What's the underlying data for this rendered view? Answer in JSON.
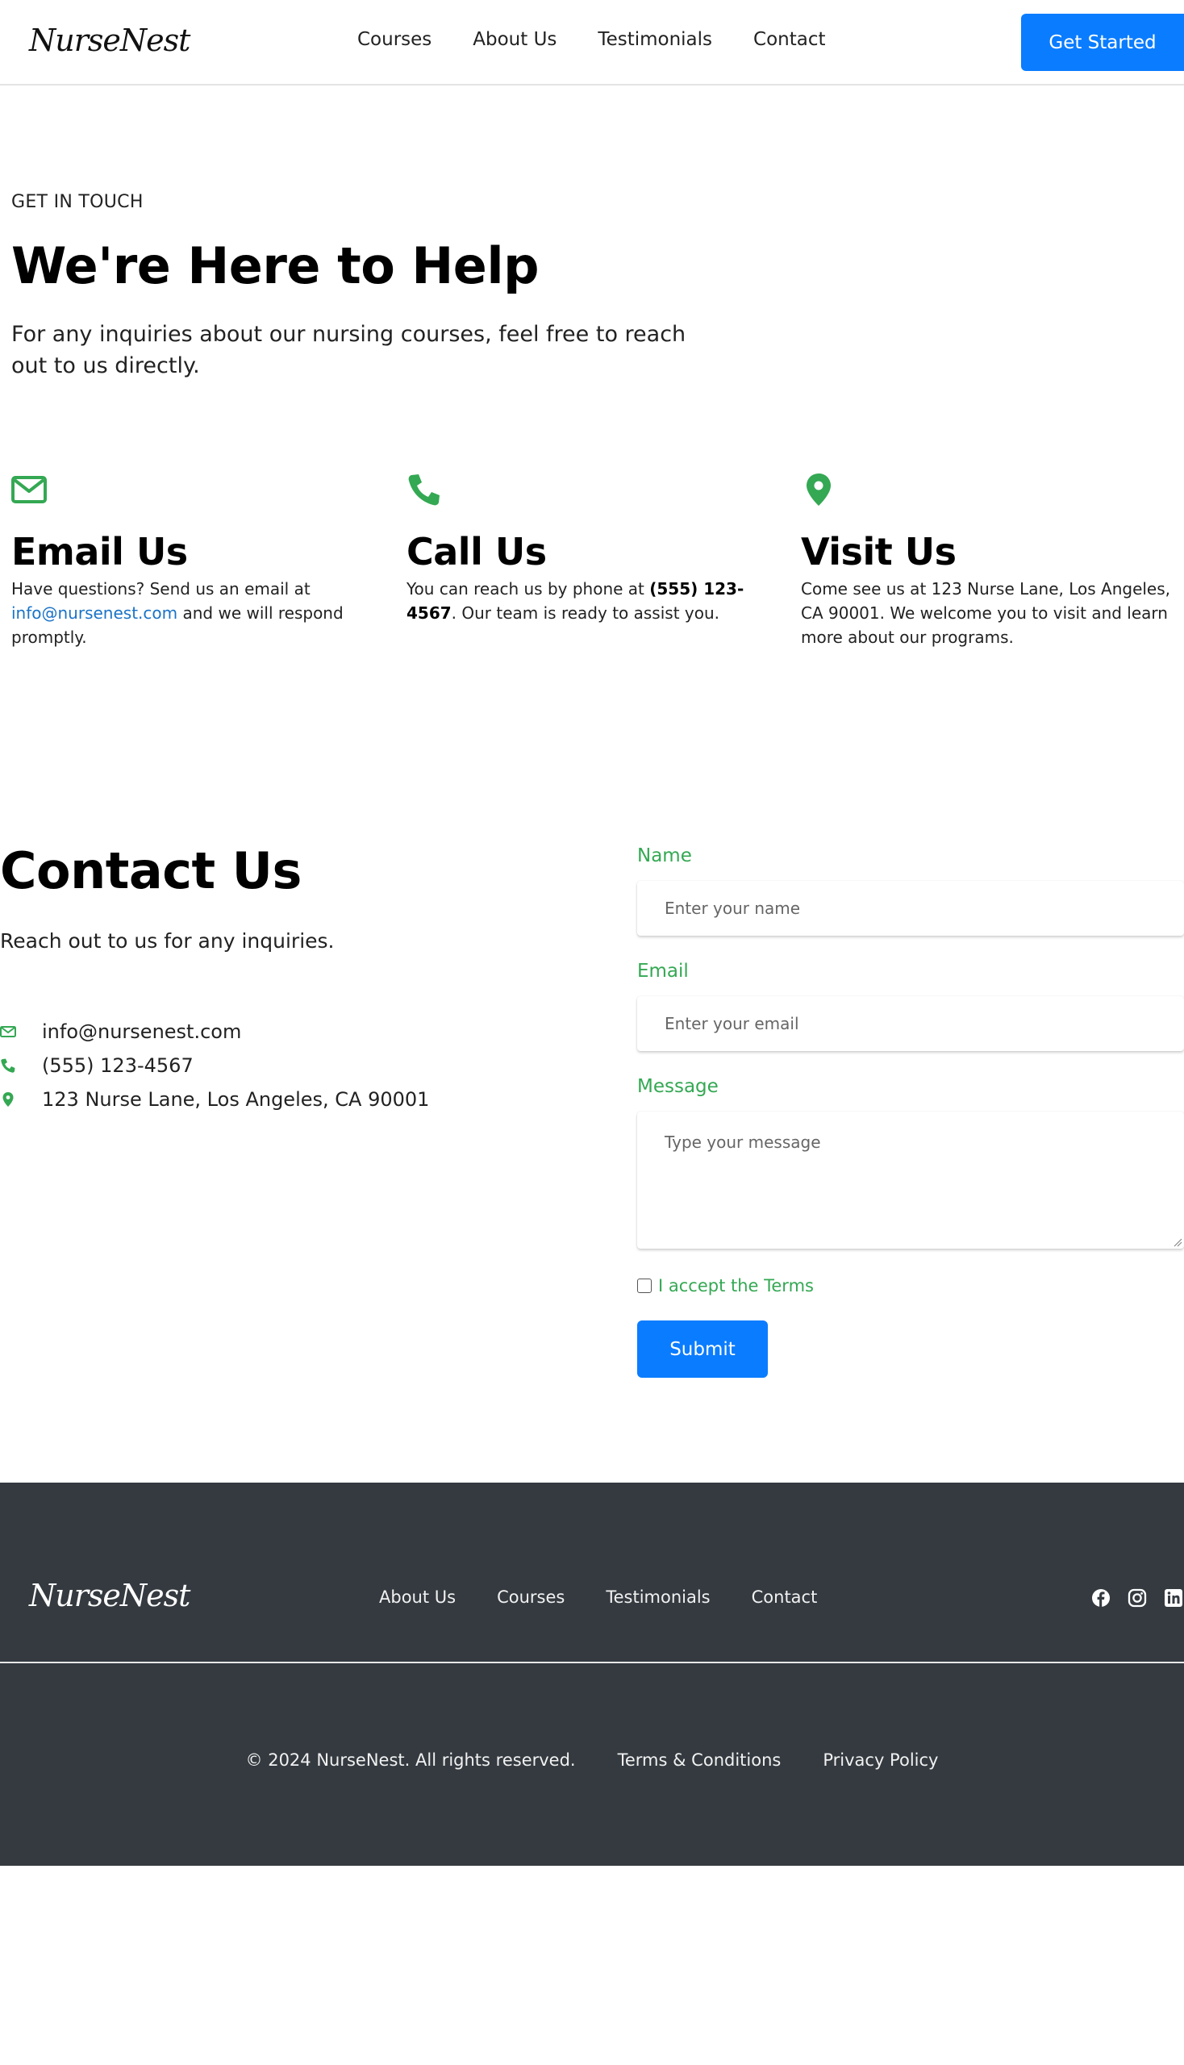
{
  "brand": {
    "name": "NurseNest"
  },
  "header": {
    "nav": [
      "Courses",
      "About Us",
      "Testimonials",
      "Contact"
    ],
    "cta_label": "Get Started"
  },
  "hero": {
    "eyebrow": "GET IN TOUCH",
    "title": "We're Here to Help",
    "subtitle": "For any inquiries about our nursing courses, feel free to reach out to us directly."
  },
  "info": {
    "email": {
      "title": "Email Us",
      "text_before": "Have questions? Send us an email at ",
      "link": "info@nursenest.com",
      "text_after": " and we will respond promptly."
    },
    "call": {
      "title": "Call Us",
      "text_before": "You can reach us by phone at ",
      "phone": "(555) 123-4567",
      "text_after": ". Our team is ready to assist you."
    },
    "visit": {
      "title": "Visit Us",
      "text": "Come see us at 123 Nurse Lane, Los Angeles, CA 90001. We welcome you to visit and learn more about our programs."
    }
  },
  "contact": {
    "title": "Contact Us",
    "subtitle": "Reach out to us for any inquiries.",
    "email": "info@nursenest.com",
    "phone": "(555) 123-4567",
    "address": "123 Nurse Lane, Los Angeles, CA 90001"
  },
  "form": {
    "name_label": "Name",
    "name_placeholder": "Enter your name",
    "email_label": "Email",
    "email_placeholder": "Enter your email",
    "message_label": "Message",
    "message_placeholder": "Type your message",
    "terms_label": "I accept the Terms",
    "submit_label": "Submit"
  },
  "footer": {
    "nav": [
      "About Us",
      "Courses",
      "Testimonials",
      "Contact"
    ],
    "social_icons": [
      "facebook-icon",
      "instagram-icon",
      "linkedin-icon"
    ],
    "copyright": "© 2024 NurseNest. All rights reserved.",
    "terms": "Terms & Conditions",
    "privacy": "Privacy Policy"
  },
  "colors": {
    "accent_blue": "#0a7cff",
    "accent_green": "#34a853",
    "link_blue": "#1a73c7",
    "footer_bg": "#343a40"
  }
}
